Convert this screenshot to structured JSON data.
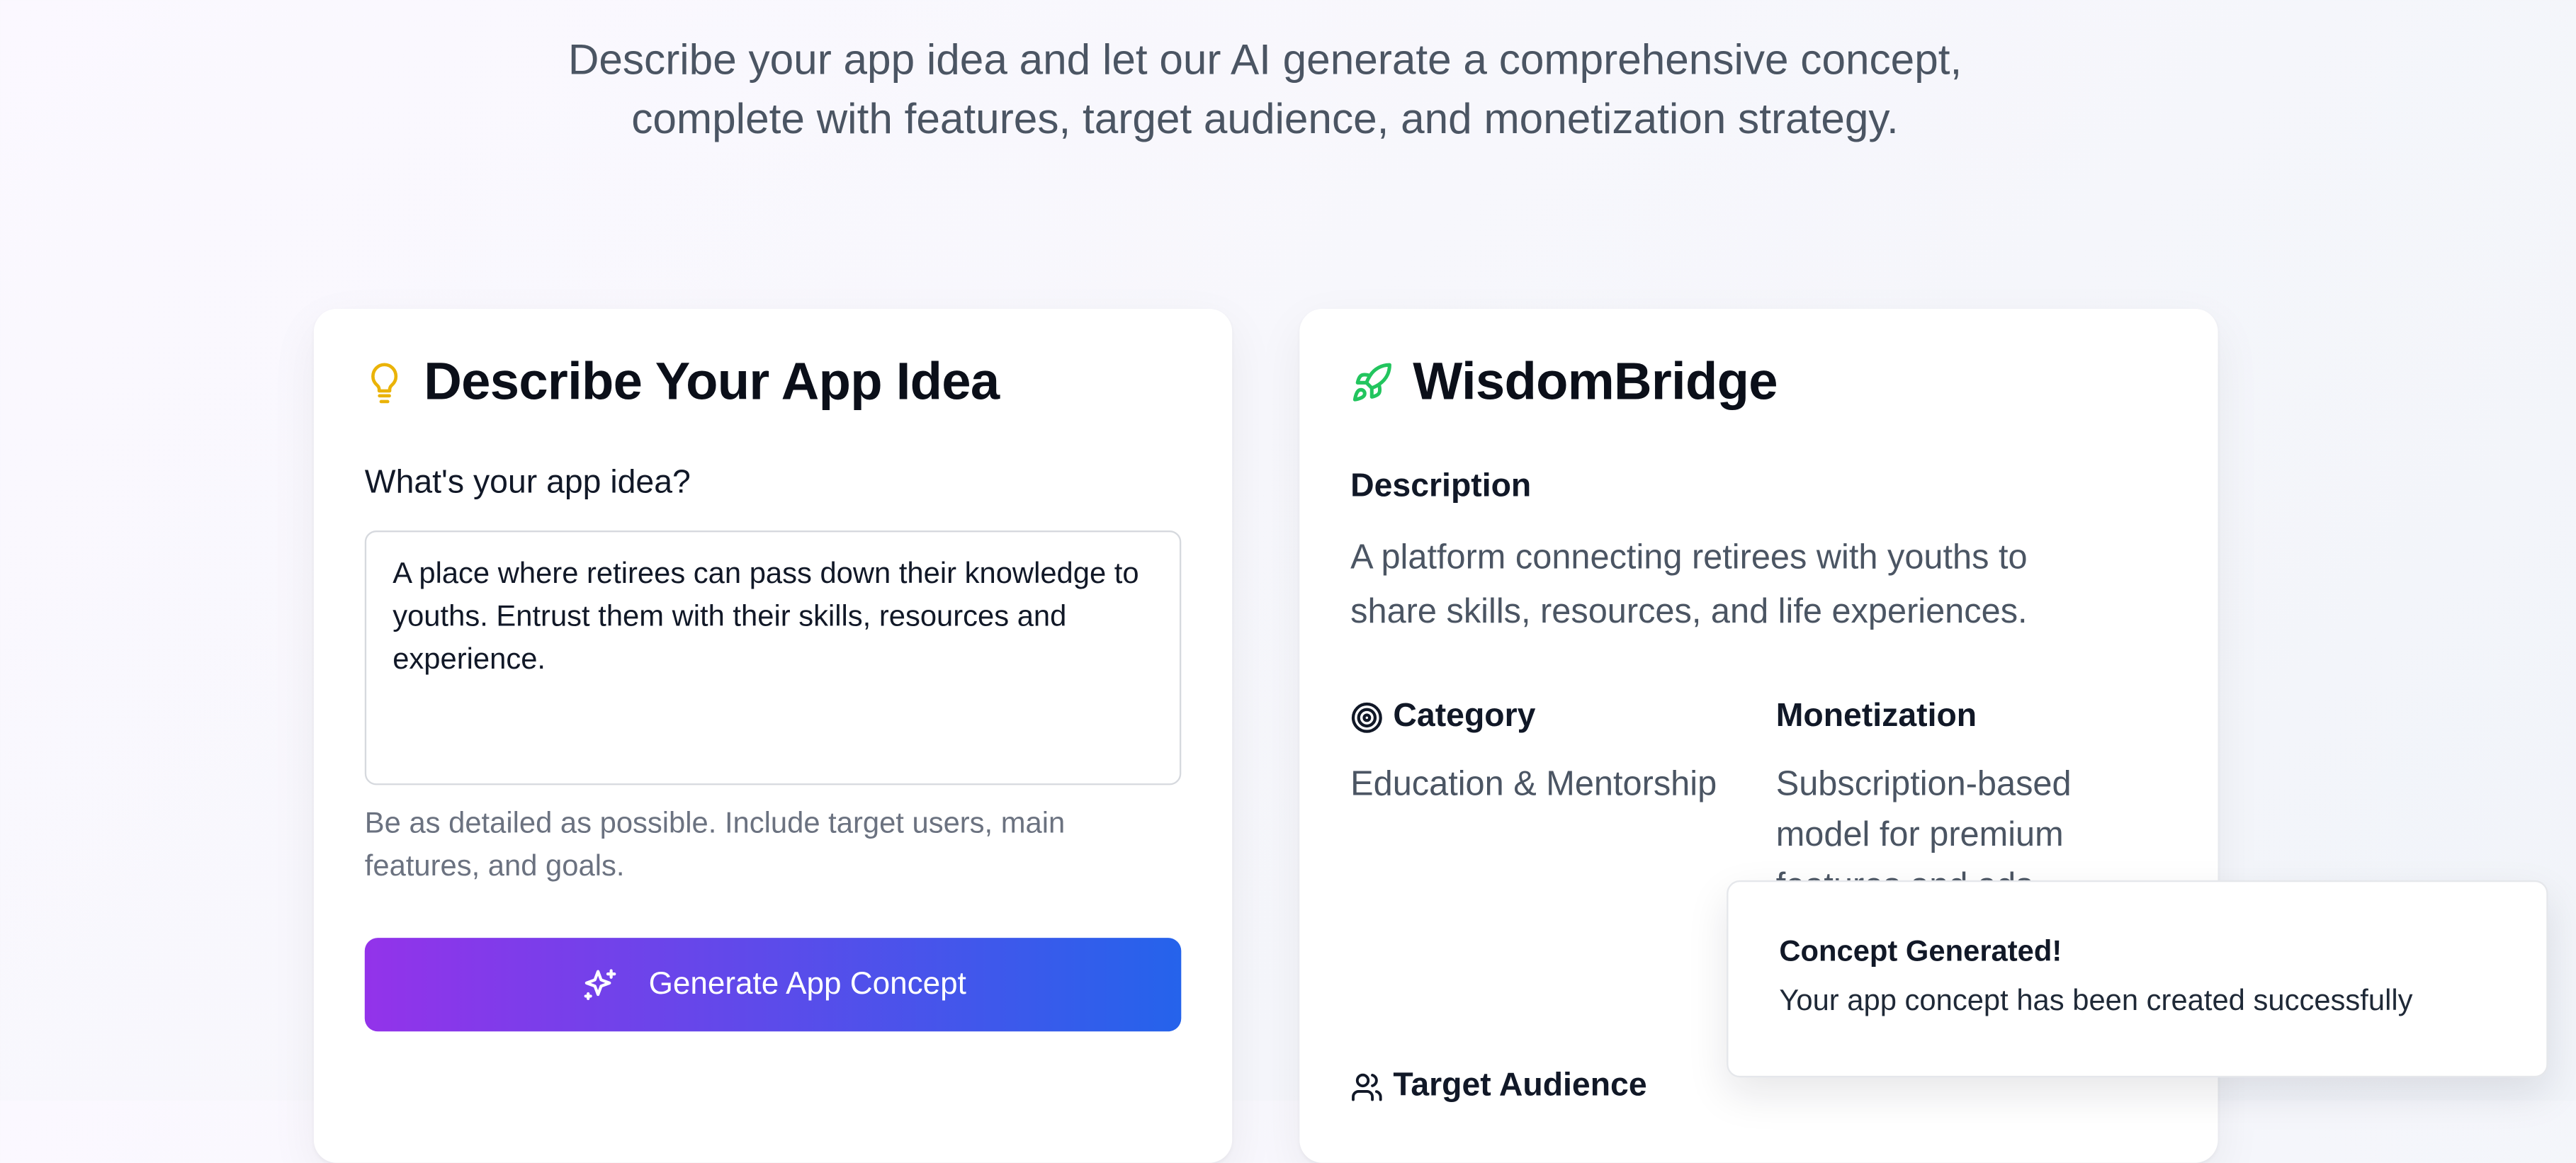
{
  "hero": {
    "subtitle": "Describe your app idea and let our AI generate a comprehensive concept, complete with features, target audience, and monetization strategy."
  },
  "input_card": {
    "title": "Describe Your App Idea",
    "title_icon": "lightbulb-icon",
    "field_label": "What's your app idea?",
    "idea_value": "A place where retirees can pass down their knowledge to youths. Entrust them with their skills, resources and experience.",
    "helper_text": "Be as detailed as possible. Include target users, main features, and goals.",
    "generate_button_label": "Generate App Concept",
    "generate_button_icon": "sparkles-icon"
  },
  "concept_card": {
    "title": "WisdomBridge",
    "title_icon": "rocket-icon",
    "description_label": "Description",
    "description": "A platform connecting retirees with youths to share skills, resources, and life experiences.",
    "category_label": "Category",
    "category_icon": "target-icon",
    "category": "Education & Mentorship",
    "monetization_label": "Monetization",
    "monetization": "Subscription-based model for premium features and ads",
    "target_audience_label": "Target Audience",
    "target_audience_icon": "users-icon"
  },
  "toast": {
    "title": "Concept Generated!",
    "message": "Your app concept has been created successfully"
  },
  "colors": {
    "accent_gradient_start": "#9333ea",
    "accent_gradient_end": "#2563eb",
    "lightbulb": "#eab308",
    "rocket": "#22c55e"
  }
}
